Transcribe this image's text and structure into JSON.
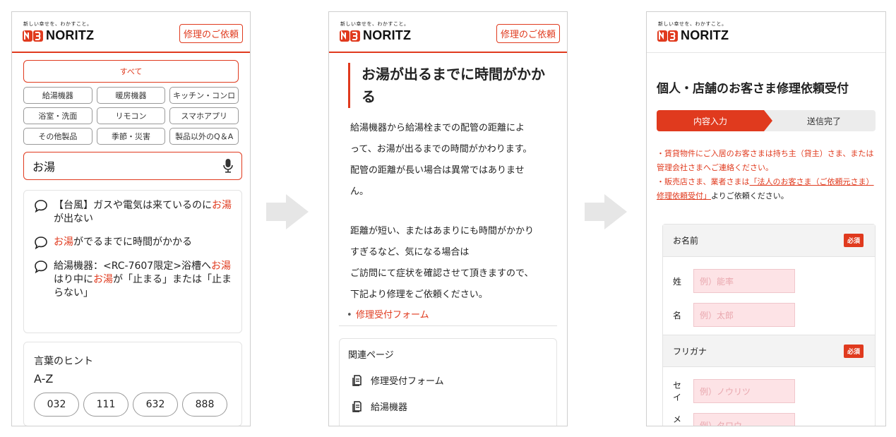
{
  "colors": {
    "accent": "#e03a1e",
    "field_bg": "#fde3e6",
    "arrow": "#e6e6e6"
  },
  "header": {
    "tagline": "新しい幸せを、わかすこと。",
    "brand": "NORITZ",
    "repair_button": "修理のご依頼"
  },
  "screen1": {
    "category_all": "すべて",
    "categories": [
      "給湯機器",
      "暖房機器",
      "キッチン・コンロ",
      "浴室・洗面",
      "リモコン",
      "スマホアプリ",
      "その他製品",
      "季節・災害",
      "製品以外のQ＆A"
    ],
    "search_value": "お湯",
    "suggestions": [
      {
        "pre": "【台風】ガスや電気は来ているのに",
        "hl1": "お湯",
        "mid": "が出ない",
        "hl2": "",
        "post": ""
      },
      {
        "pre": "",
        "hl1": "お湯",
        "mid": "がでるまでに時間がかかる",
        "hl2": "",
        "post": ""
      },
      {
        "pre": "給湯機器：<RC-7607限定>浴槽へ",
        "hl1": "お湯",
        "mid": "はり中に",
        "hl2": "お湯",
        "post": "が「止まる」または「止まらない」"
      }
    ],
    "hint_title": "言葉のヒント",
    "hint_subtitle": "A-Z",
    "hint_numbers": [
      "032",
      "111",
      "632",
      "888"
    ]
  },
  "screen2": {
    "title": "お湯が出るまでに時間がかかる",
    "para1": [
      "給湯機器から給湯栓までの配管の距離によ",
      "って、お湯が出るまでの時間がかわります。",
      "配管の距離が長い場合は異常ではありませ",
      "ん。"
    ],
    "para2": [
      "距離が短い、またはあまりにも時間がかかり",
      "すぎるなど、気になる場合は",
      "ご訪問にて症状を確認させて頂きますので、",
      "下記より修理をご依頼ください。"
    ],
    "link": "修理受付フォーム",
    "related_title": "関連ページ",
    "related_items": [
      "修理受付フォーム",
      "給湯機器"
    ]
  },
  "screen3": {
    "title": "個人・店舗のお客さま修理依頼受付",
    "step_active": "内容入力",
    "step_next": "送信完了",
    "notice1": "・賃貸物件にご入居のお客さまは持ち主（貸主）さま、または管理会社さまへご連絡ください。",
    "notice2_pre": "・販売店さま、業者さまは",
    "notice2_link": "「法人のお客さま（ご依頼元さま）修理依頼受付」",
    "notice2_post": "よりご依頼ください。",
    "required_badge": "必須",
    "name_label": "お名前",
    "sei_label": "姓",
    "sei_placeholder": "例）能率",
    "mei_label": "名",
    "mei_placeholder": "例）太郎",
    "kana_label": "フリガナ",
    "sei_kana_label": "セイ",
    "sei_kana_placeholder": "例）ノウリツ",
    "mei_kana_label": "メイ",
    "mei_kana_placeholder": "例）タロウ"
  }
}
